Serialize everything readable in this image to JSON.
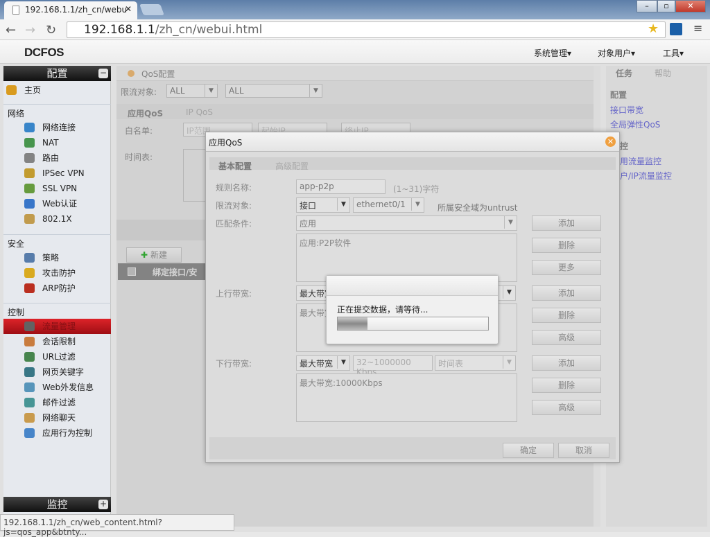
{
  "browser": {
    "tab_title": "192.168.1.1/zh_cn/webu",
    "url_host": "192.168.1.1",
    "url_path": "/zh_cn/webui.html",
    "status_url": "192.168.1.1/zh_cn/web_content.html?js=qos_app&btnty..."
  },
  "header": {
    "logo": "DCFOS",
    "menus": [
      "系统管理▾",
      "对象用户▾",
      "工具▾"
    ]
  },
  "sidebar": {
    "config_title": "配置",
    "home": "主页",
    "sections": [
      {
        "title": "网络",
        "items": [
          "网络连接",
          "NAT",
          "路由",
          "IPSec VPN",
          "SSL VPN",
          "Web认证",
          "802.1X"
        ]
      },
      {
        "title": "安全",
        "items": [
          "策略",
          "攻击防护",
          "ARP防护"
        ]
      },
      {
        "title": "控制",
        "items": [
          "流量管理",
          "会话限制",
          "URL过滤",
          "网页关键字",
          "Web外发信息",
          "邮件过滤",
          "网络聊天",
          "应用行为控制"
        ]
      }
    ],
    "active_item": "流量管理",
    "monitor_title": "监控"
  },
  "main": {
    "title": "QoS配置",
    "limit_label": "限流对象:",
    "limit_sel1": "ALL",
    "limit_sel2": "ALL",
    "tabs": [
      "应用QoS",
      "IP QoS"
    ],
    "whitelist_label": "白名单:",
    "ip_range": "IP范围",
    "start_ip": "起始IP",
    "end_ip": "终止IP",
    "schedule_label": "时间表:",
    "new_button": "新建",
    "col_header": "绑定接口/安"
  },
  "right": {
    "tabs": [
      "任务",
      "帮助"
    ],
    "config_title": "配置",
    "config_links": [
      "接口带宽",
      "全局弹性QoS"
    ],
    "monitor_title": "控",
    "monitor_links": [
      "用流量监控",
      "户/IP流量监控"
    ]
  },
  "dialog": {
    "title": "应用QoS",
    "tabs": [
      "基本配置",
      "高级配置"
    ],
    "rule_name_label": "规则名称:",
    "rule_name": "app-p2p",
    "rule_hint": "(1~31)字符",
    "limit_label": "限流对象:",
    "limit_type": "接口",
    "limit_iface": "ethernet0/1",
    "zone_hint": "所属安全域为untrust",
    "match_label": "匹配条件:",
    "match_sel": "应用",
    "match_list": "应用:P2P软件",
    "up_label": "上行带宽:",
    "up_sel": "最大带宽",
    "up_list": "最大带宽",
    "down_label": "下行带宽:",
    "down_sel": "最大带宽",
    "down_range": "32~1000000 Kbps",
    "down_sched": "时间表",
    "down_list": "最大带宽:10000Kbps",
    "buttons": {
      "add": "添加",
      "del": "删除",
      "more": "更多",
      "adv": "高级"
    },
    "ok": "确定",
    "cancel": "取消"
  },
  "progress": {
    "message": "正在提交数据，请等待...",
    "percent": 20
  }
}
